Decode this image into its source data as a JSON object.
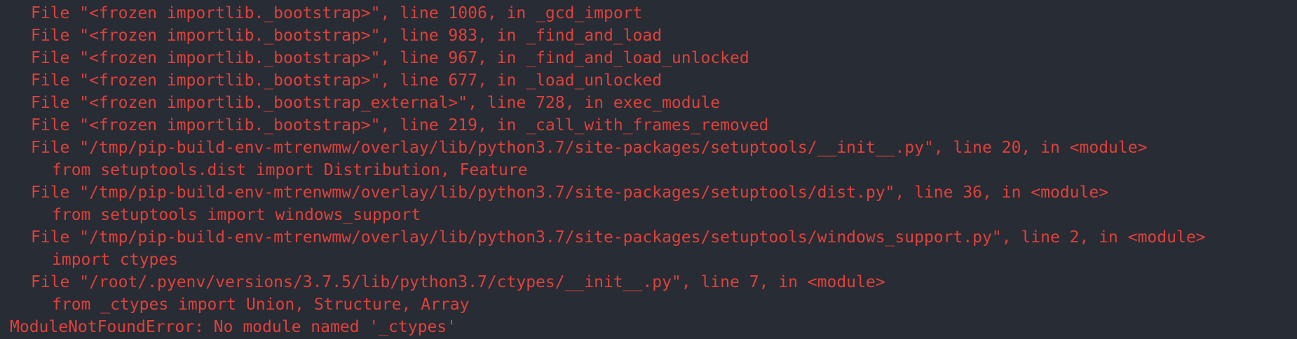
{
  "terminal": {
    "text_color": "#e0413b",
    "background_color": "#282c34",
    "lines": [
      {
        "text": "File \"<frozen importlib._bootstrap>\", line 1006, in _gcd_import"
      },
      {
        "text": "File \"<frozen importlib._bootstrap>\", line 983, in _find_and_load"
      },
      {
        "text": "File \"<frozen importlib._bootstrap>\", line 967, in _find_and_load_unlocked"
      },
      {
        "text": "File \"<frozen importlib._bootstrap>\", line 677, in _load_unlocked"
      },
      {
        "text": "File \"<frozen importlib._bootstrap_external>\", line 728, in exec_module"
      },
      {
        "text": "File \"<frozen importlib._bootstrap>\", line 219, in _call_with_frames_removed"
      },
      {
        "text": "File \"/tmp/pip-build-env-mtrenwmw/overlay/lib/python3.7/site-packages/setuptools/__init__.py\", line 20, in <module>"
      },
      {
        "text": "from setuptools.dist import Distribution, Feature"
      },
      {
        "text": "File \"/tmp/pip-build-env-mtrenwmw/overlay/lib/python3.7/site-packages/setuptools/dist.py\", line 36, in <module>"
      },
      {
        "text": "from setuptools import windows_support"
      },
      {
        "text": "File \"/tmp/pip-build-env-mtrenwmw/overlay/lib/python3.7/site-packages/setuptools/windows_support.py\", line 2, in <module>"
      },
      {
        "text": "import ctypes"
      },
      {
        "text": "File \"/root/.pyenv/versions/3.7.5/lib/python3.7/ctypes/__init__.py\", line 7, in <module>"
      },
      {
        "text": "from _ctypes import Union, Structure, Array"
      },
      {
        "text": "ModuleNotFoundError: No module named '_ctypes'"
      }
    ]
  }
}
